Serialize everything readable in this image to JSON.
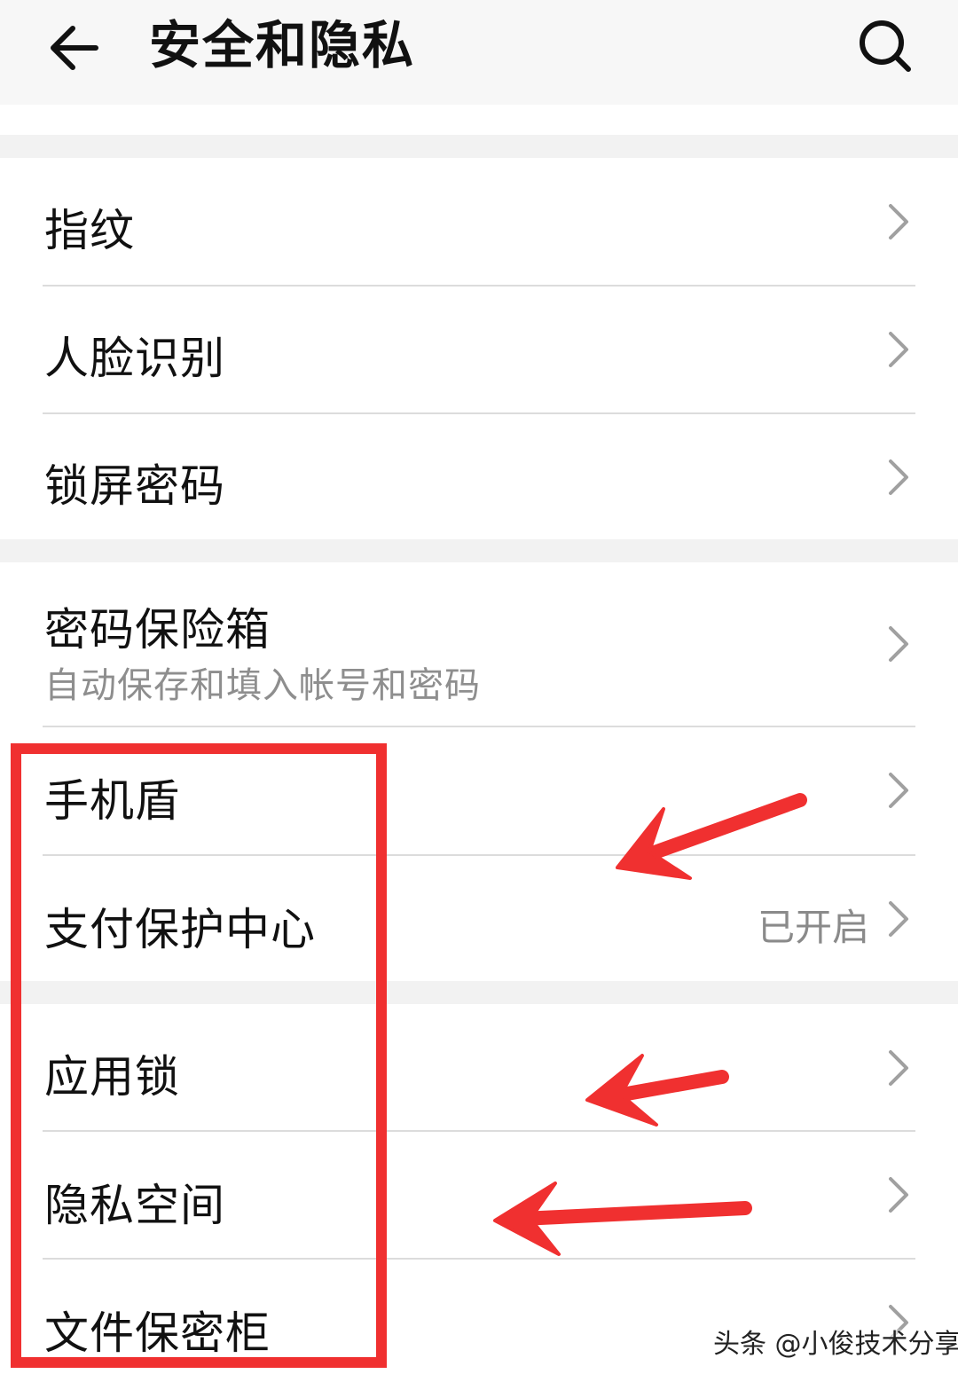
{
  "header": {
    "title": "安全和隐私",
    "back_icon": "arrow-left-icon",
    "search_icon": "search-icon"
  },
  "groups": [
    {
      "items": [
        {
          "label": "指纹"
        },
        {
          "label": "人脸识别"
        },
        {
          "label": "锁屏密码"
        }
      ]
    },
    {
      "items": [
        {
          "label": "密码保险箱",
          "sub": "自动保存和填入帐号和密码"
        },
        {
          "label": "手机盾"
        },
        {
          "label": "支付保护中心",
          "value": "已开启"
        }
      ]
    },
    {
      "items": [
        {
          "label": "应用锁"
        },
        {
          "label": "隐私空间"
        },
        {
          "label": "文件保密柜"
        }
      ]
    }
  ],
  "annotations": {
    "highlight_color": "#f03030",
    "arrow_color": "#f03030"
  },
  "watermark": "头条 @小俊技术分享",
  "colors": {
    "header_bg": "#f7f7f7",
    "page_bg": "#f2f2f2",
    "row_bg": "#ffffff",
    "text_primary": "#111111",
    "text_secondary": "#8e8e8e",
    "chevron": "#a0a0a0"
  }
}
